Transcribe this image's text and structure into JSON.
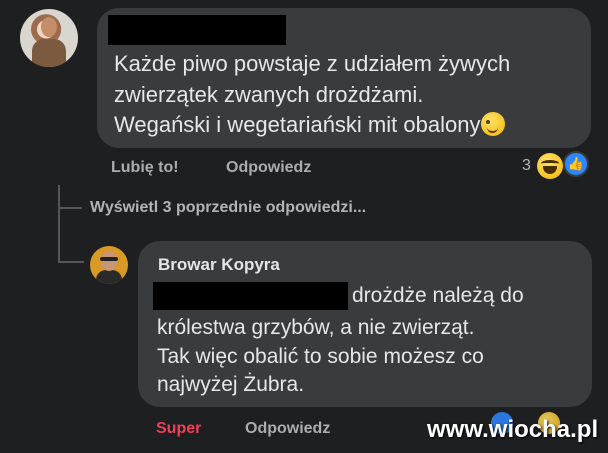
{
  "comment1": {
    "text_lines": [
      "Każde piwo powstaje z udziałem żywych",
      "zwierzątek zwanych drożdżami.",
      "Wegański i wegetariański mit obalony"
    ],
    "trailing_emoji": "wink-emoji",
    "actions": {
      "like": "Lubię to!",
      "reply": "Odpowiedz"
    },
    "reactions": {
      "count": "3",
      "icons": [
        "haha-icon",
        "like-icon"
      ]
    }
  },
  "thread": {
    "view_previous": "Wyświetl 3 poprzednie odpowiedzi..."
  },
  "comment2": {
    "author": "Browar Kopyra",
    "first_line_tail": "drożdże należą do",
    "text_lines": [
      "królestwa grzybów, a nie zwierząt.",
      "Tak więc obalić to sobie możesz co",
      "najwyżej Żubra."
    ],
    "actions": {
      "reaction": "Super",
      "reply": "Odpowiedz"
    },
    "reaction_color": "#f33e58"
  },
  "watermark": "www.wiocha.pl",
  "colors": {
    "background": "#1e1f20",
    "bubble": "#3a3b3c",
    "text": "#e4e6eb",
    "muted": "#b0b3b8",
    "like_blue": "#2d88ff"
  }
}
